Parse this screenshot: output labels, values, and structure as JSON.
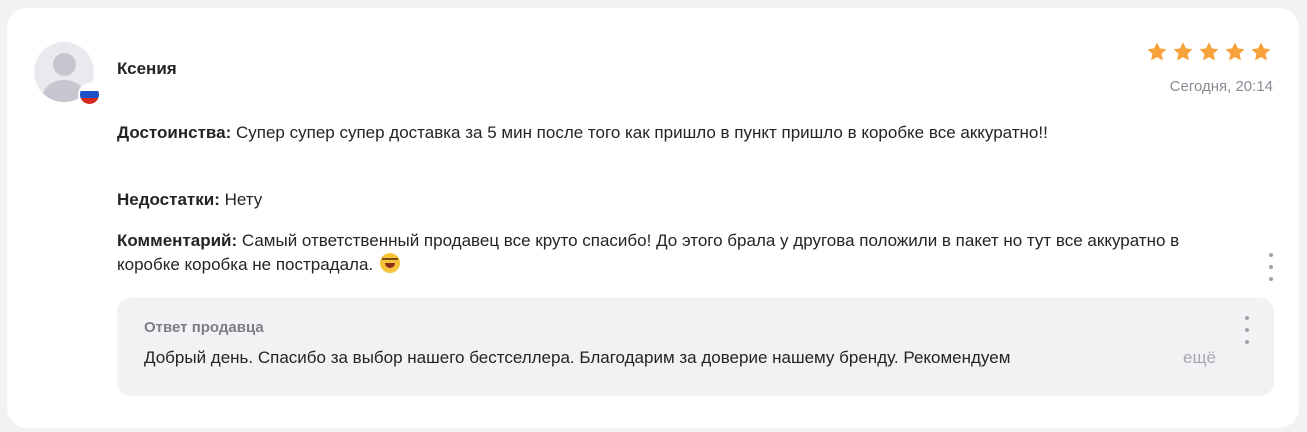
{
  "review": {
    "author": "Ксения",
    "rating": 5,
    "rating_max": 5,
    "star_color": "#f9a23b",
    "date": "Сегодня, 20:14",
    "country_flag_icon": "russia-flag-icon",
    "pros_label": "Достоинства:",
    "pros_text": "Супер супер супер доставка за 5 мин после того как пришло в пункт пришло в коробке все аккуратно!!",
    "cons_label": "Недостатки:",
    "cons_text": "Нету",
    "comment_label": "Комментарий:",
    "comment_text": "Самый ответственный продавец все круто спасибо! До этого брала у другова положили в пакет но тут все аккуратно в коробке коробка не пострадала.",
    "comment_emoji_icon": "laughing-emoji-icon",
    "menu_icon": "more-vertical-icon"
  },
  "seller_reply": {
    "title": "Ответ продавца",
    "text": "Добрый день. Спасибо за выбор нашего бестселлера. Благодарим за доверие нашему бренду. Рекомендуем",
    "more_label": "ещё",
    "menu_icon": "more-vertical-icon"
  }
}
